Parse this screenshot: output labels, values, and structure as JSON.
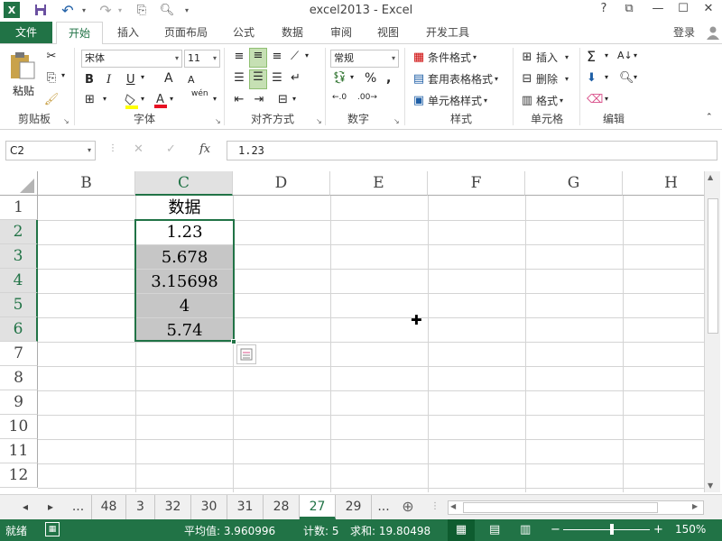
{
  "title": "excel2013 - Excel",
  "window": {
    "help": "?",
    "ribbon_opts": "⧉",
    "minimize": "—",
    "maximize": "☐",
    "close": "✕"
  },
  "tabs": [
    "文件",
    "开始",
    "插入",
    "页面布局",
    "公式",
    "数据",
    "审阅",
    "视图",
    "开发工具"
  ],
  "login": "登录",
  "ribbon": {
    "clipboard": {
      "paste": "粘贴",
      "label": "剪贴板"
    },
    "font": {
      "name": "宋体",
      "size": "11",
      "bold": "B",
      "italic": "I",
      "underline": "U",
      "grow": "A",
      "shrink": "A",
      "phonetic": "wén",
      "label": "字体"
    },
    "alignment": {
      "label": "对齐方式"
    },
    "number": {
      "format": "常规",
      "percent": "%",
      "label": "数字"
    },
    "styles": {
      "cond": "条件格式",
      "table": "套用表格格式",
      "cell": "单元格样式",
      "label": "样式"
    },
    "cells": {
      "insert": "插入",
      "delete": "删除",
      "format": "格式",
      "label": "单元格"
    },
    "editing": {
      "label": "编辑"
    }
  },
  "formula_bar": {
    "name_box": "C2",
    "fx": "fx",
    "cancel": "✕",
    "enter": "✓",
    "value": "1.23"
  },
  "grid": {
    "columns": [
      "B",
      "C",
      "D",
      "E",
      "F",
      "G",
      "H"
    ],
    "rows": [
      "1",
      "2",
      "3",
      "4",
      "5",
      "6",
      "7",
      "8",
      "9",
      "10",
      "11",
      "12"
    ],
    "c_cells": [
      "数据",
      "1.23",
      "5.678",
      "3.15698",
      "4",
      "5.74"
    ]
  },
  "sheets": {
    "nav_prev": "◂",
    "nav_next": "▸",
    "more": "...",
    "more2": "...",
    "add": "⊕",
    "names": [
      "48",
      "3",
      "32",
      "30",
      "31",
      "28",
      "27",
      "29"
    ],
    "active": "27"
  },
  "status": {
    "ready": "就绪",
    "average": "平均值: 3.960996",
    "count": "计数: 5",
    "sum": "求和: 19.80498",
    "zoom_minus": "−",
    "zoom_plus": "+",
    "zoom": "150%"
  },
  "colors": {
    "accent": "#217346",
    "selection_fill": "#c6c6c6"
  }
}
